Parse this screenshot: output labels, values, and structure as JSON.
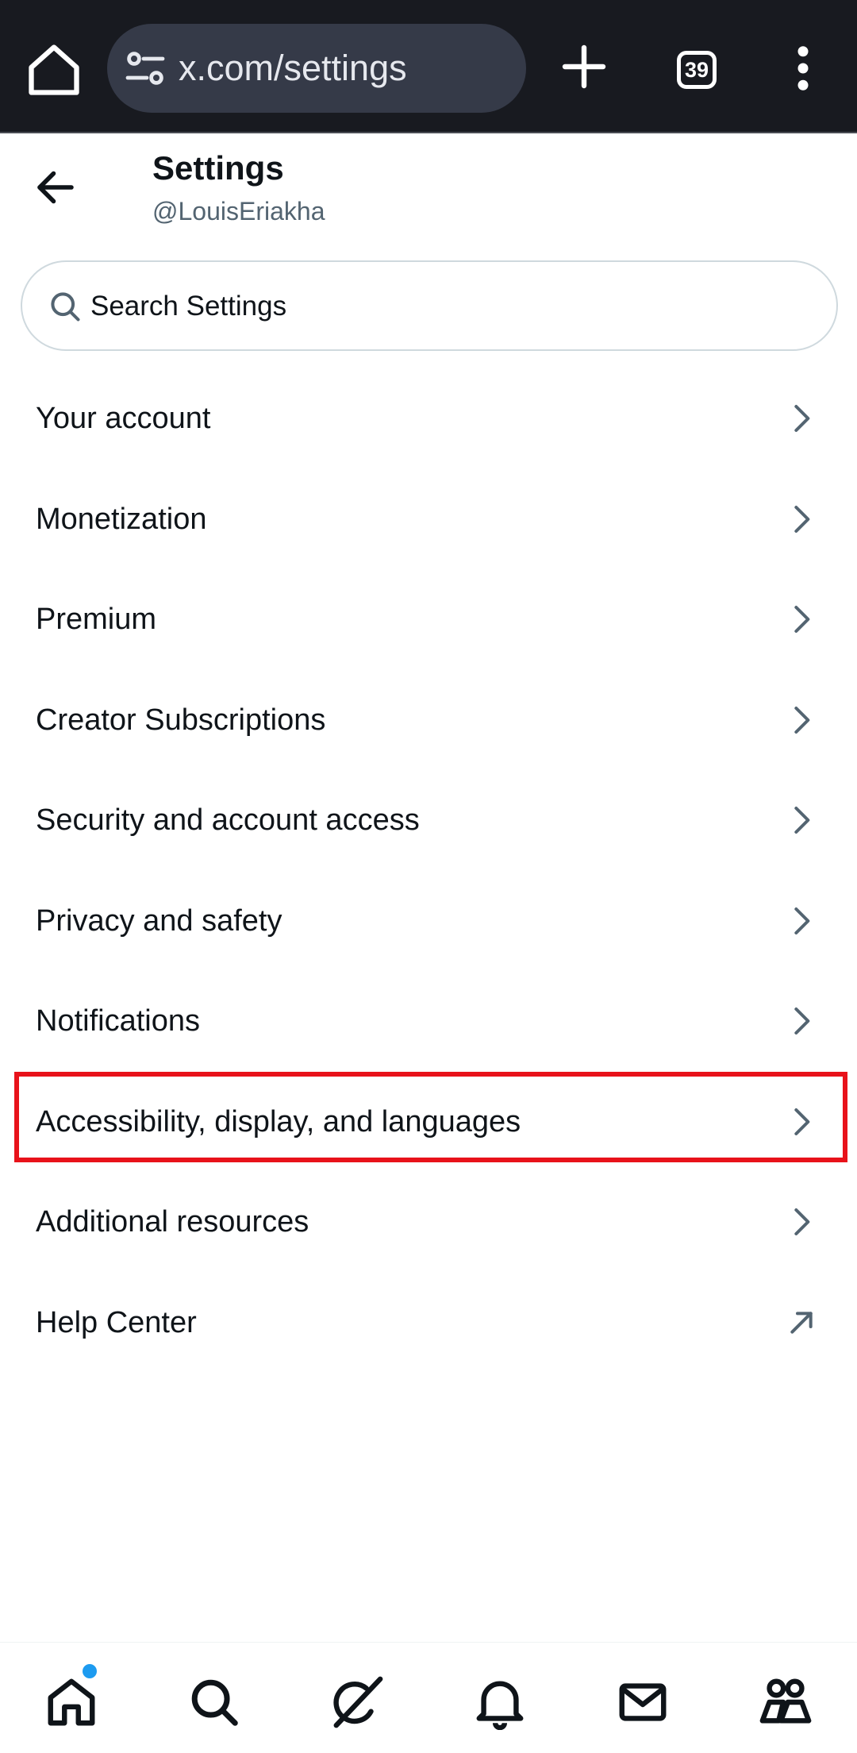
{
  "browser": {
    "url": "x.com/settings",
    "tab_count": "39"
  },
  "header": {
    "title": "Settings",
    "handle": "@LouisEriakha"
  },
  "search": {
    "placeholder": "Search Settings"
  },
  "menu": {
    "items": [
      {
        "label": "Your account",
        "icon": "chevron-right-icon"
      },
      {
        "label": "Monetization",
        "icon": "chevron-right-icon"
      },
      {
        "label": "Premium",
        "icon": "chevron-right-icon"
      },
      {
        "label": "Creator Subscriptions",
        "icon": "chevron-right-icon"
      },
      {
        "label": "Security and account access",
        "icon": "chevron-right-icon"
      },
      {
        "label": "Privacy and safety",
        "icon": "chevron-right-icon"
      },
      {
        "label": "Notifications",
        "icon": "chevron-right-icon"
      },
      {
        "label": "Accessibility, display, and languages",
        "icon": "chevron-right-icon"
      },
      {
        "label": "Additional resources",
        "icon": "chevron-right-icon"
      },
      {
        "label": "Help Center",
        "icon": "external-link-arrow-icon"
      }
    ],
    "highlighted_index": 7,
    "highlight_color": "#e8121a"
  },
  "bottom_nav": {
    "items": [
      "home-icon",
      "search-icon",
      "grok-icon",
      "notifications-bell-icon",
      "messages-envelope-icon",
      "communities-icon"
    ],
    "notification_dot_color": "#1d9bf0"
  },
  "colors": {
    "browser_bg": "#181a20",
    "url_pill_bg": "#353a48",
    "text_primary": "#0f1419",
    "text_secondary": "#536471"
  }
}
